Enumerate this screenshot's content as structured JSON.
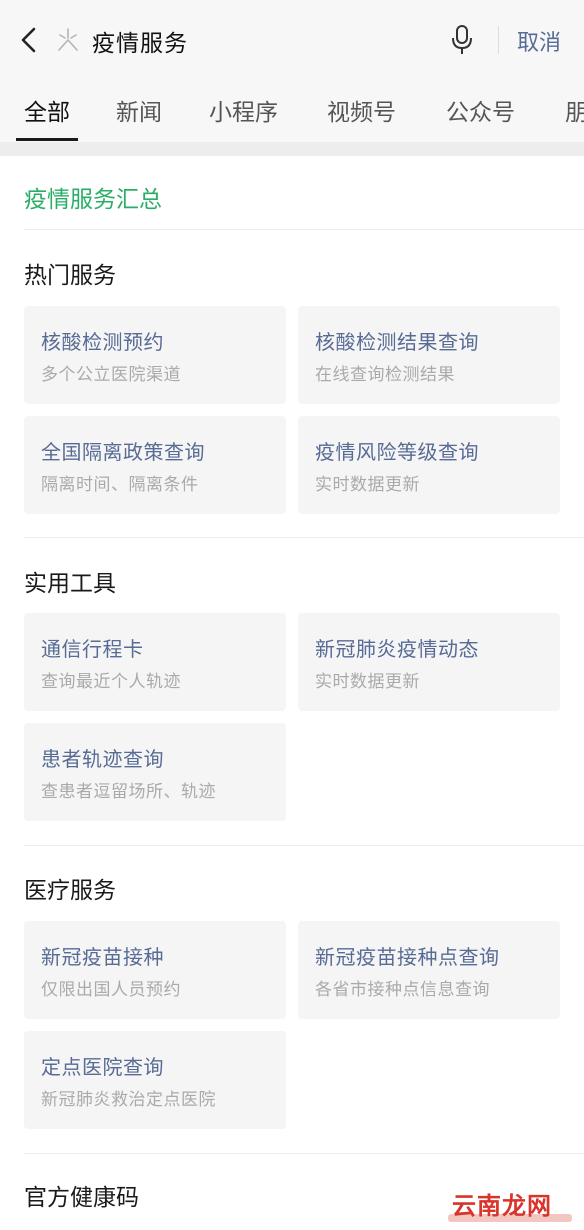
{
  "header": {
    "search_query": "疫情服务",
    "cancel_label": "取消"
  },
  "tabs": [
    {
      "label": "全部"
    },
    {
      "label": "新闻"
    },
    {
      "label": "小程序"
    },
    {
      "label": "视频号"
    },
    {
      "label": "公众号"
    },
    {
      "label": "朋"
    }
  ],
  "summary": {
    "title": "疫情服务汇总"
  },
  "sections": [
    {
      "title": "热门服务",
      "cards": [
        {
          "title": "核酸检测预约",
          "subtitle": "多个公立医院渠道"
        },
        {
          "title": "核酸检测结果查询",
          "subtitle": "在线查询检测结果"
        },
        {
          "title": "全国隔离政策查询",
          "subtitle": "隔离时间、隔离条件"
        },
        {
          "title": "疫情风险等级查询",
          "subtitle": "实时数据更新"
        }
      ]
    },
    {
      "title": "实用工具",
      "cards": [
        {
          "title": "通信行程卡",
          "subtitle": "查询最近个人轨迹"
        },
        {
          "title": "新冠肺炎疫情动态",
          "subtitle": "实时数据更新"
        },
        {
          "title": "患者轨迹查询",
          "subtitle": "查患者逗留场所、轨迹"
        }
      ]
    },
    {
      "title": "医疗服务",
      "cards": [
        {
          "title": "新冠疫苗接种",
          "subtitle": "仅限出国人员预约"
        },
        {
          "title": "新冠疫苗接种点查询",
          "subtitle": "各省市接种点信息查询"
        },
        {
          "title": "定点医院查询",
          "subtitle": "新冠肺炎救治定点医院"
        }
      ]
    },
    {
      "title": "官方健康码",
      "cards": []
    }
  ],
  "watermark": {
    "text": "云南龙网"
  },
  "colors": {
    "accent_green": "#2aae67",
    "link_blue": "#576b95",
    "card_bg": "#f5f5f5",
    "subtitle_gray": "#aaaaaa"
  }
}
